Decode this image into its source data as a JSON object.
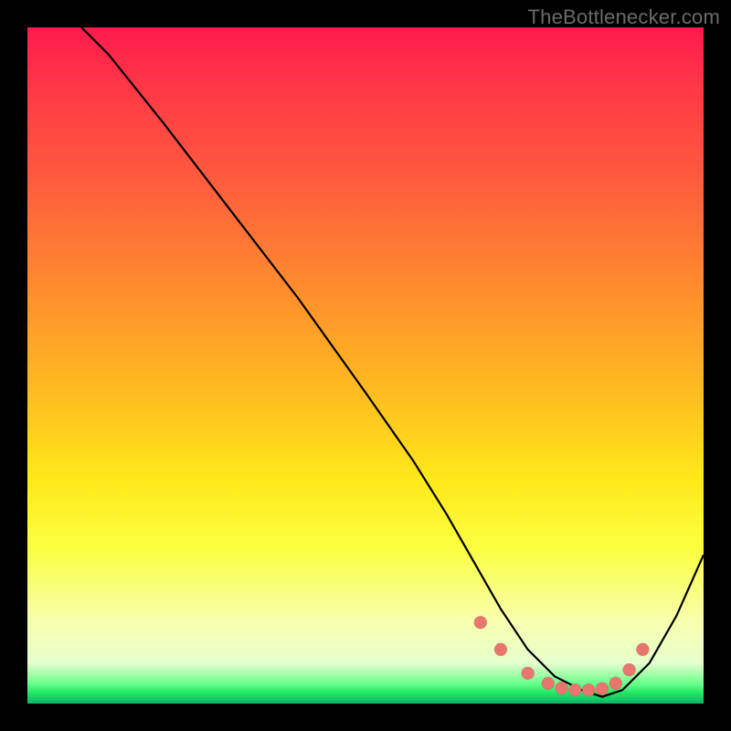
{
  "watermark": "TheBottlenecker.com",
  "chart_data": {
    "type": "line",
    "title": "",
    "xlabel": "",
    "ylabel": "",
    "xlim": [
      0,
      100
    ],
    "ylim": [
      0,
      100
    ],
    "series": [
      {
        "name": "curve",
        "x": [
          8,
          12,
          20,
          30,
          40,
          50,
          57,
          62,
          66,
          70,
          74,
          78,
          82,
          85,
          88,
          92,
          96,
          100
        ],
        "y": [
          100,
          96,
          86,
          73,
          60,
          46,
          36,
          28,
          21,
          14,
          8,
          4,
          2,
          1,
          2,
          6,
          13,
          22
        ]
      }
    ],
    "markers": {
      "name": "highlight-dots",
      "x": [
        67,
        70,
        74,
        77,
        79,
        81,
        83,
        85,
        87,
        89,
        91
      ],
      "y": [
        12,
        8,
        4.5,
        3,
        2.3,
        2,
        2,
        2.2,
        3,
        5,
        8
      ]
    },
    "gradient_stops": [
      {
        "pos": 0,
        "color": "#ff1a4d"
      },
      {
        "pos": 22,
        "color": "#ff5a3e"
      },
      {
        "pos": 55,
        "color": "#ffbf1f"
      },
      {
        "pos": 77,
        "color": "#fbff3f"
      },
      {
        "pos": 94,
        "color": "#e6ffcc"
      },
      {
        "pos": 98,
        "color": "#1ee862"
      },
      {
        "pos": 100,
        "color": "#0db36a"
      }
    ]
  }
}
